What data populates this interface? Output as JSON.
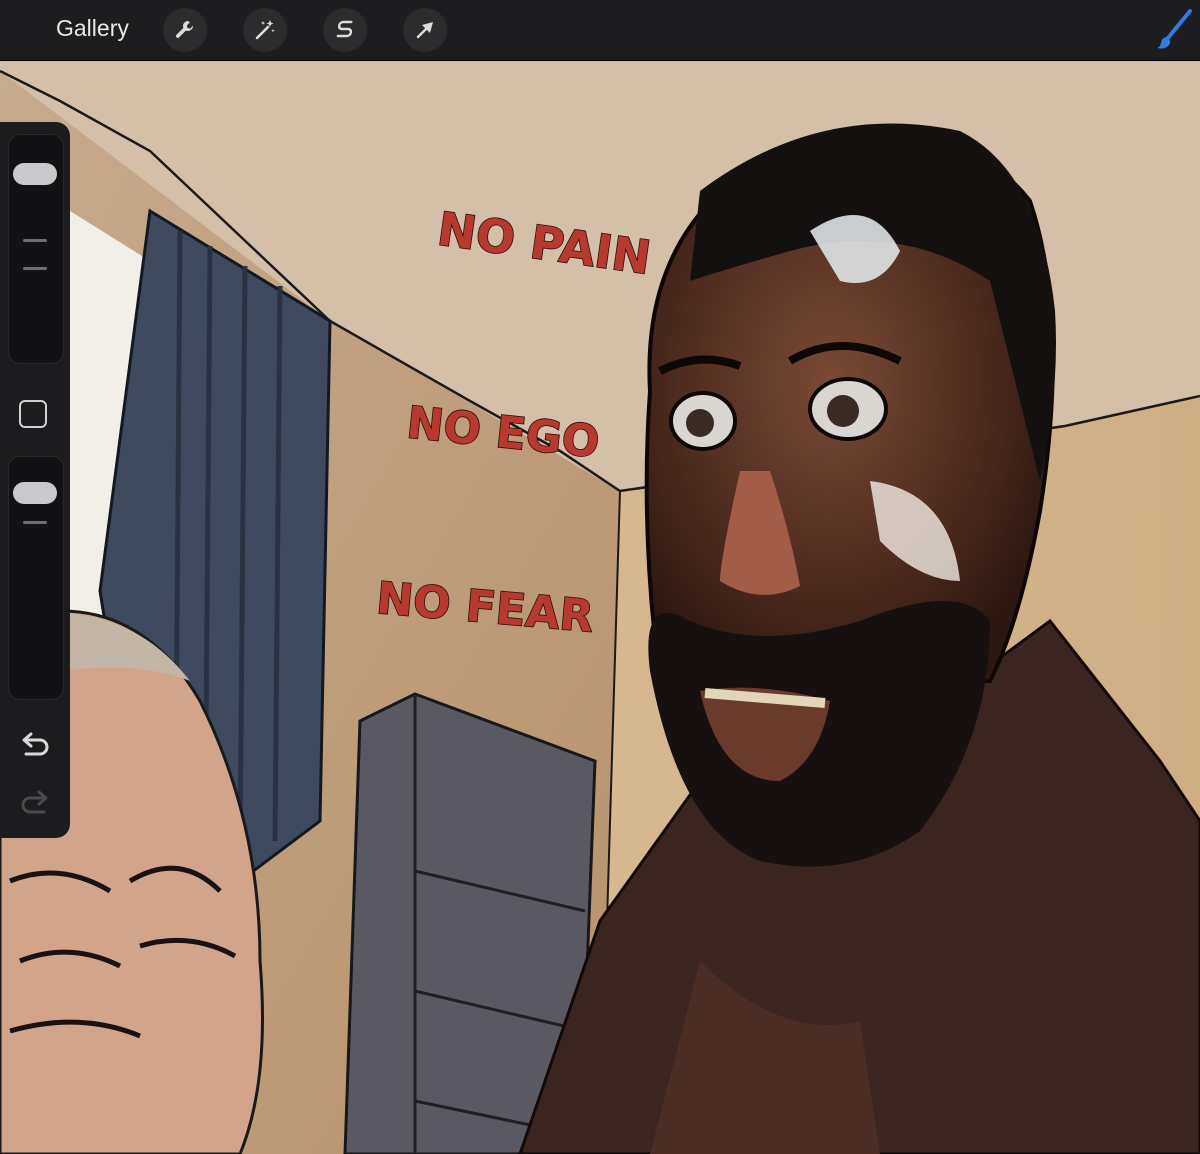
{
  "toolbar": {
    "gallery_label": "Gallery",
    "tools": [
      {
        "icon": "wrench-icon",
        "name": "actions"
      },
      {
        "icon": "magic-wand-icon",
        "name": "adjustments"
      },
      {
        "icon": "selection-s-icon",
        "name": "selection"
      },
      {
        "icon": "arrow-cursor-icon",
        "name": "transform"
      }
    ],
    "active_tool_icon": "paintbrush-icon",
    "active_tool_color": "#2f7de1"
  },
  "sidebar": {
    "brush_size_level": 0.88,
    "opacity_level": 0.9,
    "modify_icon": "square-icon",
    "undo_icon": "undo-arrow-icon",
    "redo_icon": "redo-arrow-icon",
    "redo_enabled": false
  },
  "artwork": {
    "wall_text": [
      "NO PAIN",
      "NO EGO",
      "NO FEAR"
    ],
    "text_color": "#b83a2e"
  }
}
